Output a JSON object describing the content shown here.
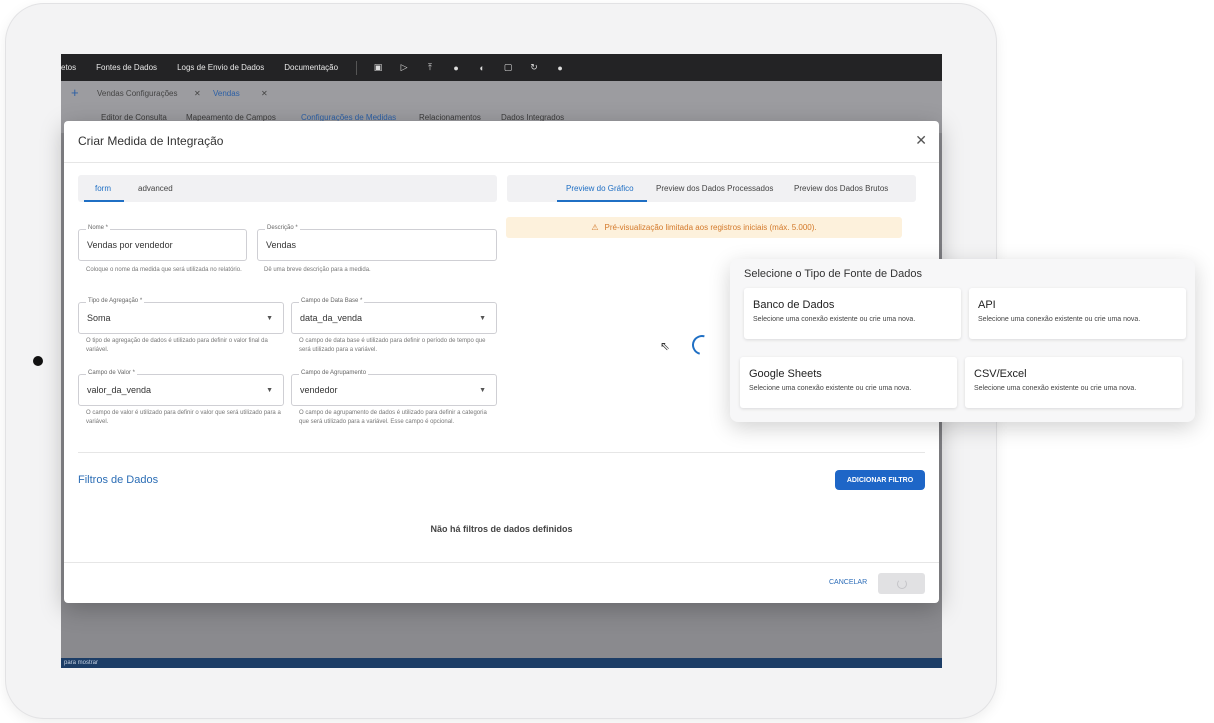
{
  "topbar": {
    "nav": [
      "etos",
      "Fontes de Dados",
      "Logs de Envio de Dados",
      "Documentação"
    ],
    "icons": [
      "save-icon",
      "play-icon",
      "upload-icon",
      "globe-icon",
      "contrast-icon",
      "chat-icon",
      "refresh-icon",
      "user-icon"
    ]
  },
  "bgtabs": {
    "plus": "+",
    "tab1": "Vendas Configurações",
    "tab2": "Vendas",
    "sub": [
      "Editor de Consulta",
      "Mapeamento de Campos",
      "Configurações de Medidas",
      "Relacionamentos",
      "Dados Integrados"
    ]
  },
  "bottom_text": "para mostrar",
  "modal": {
    "title": "Criar Medida de Integração",
    "close": "✕",
    "tabs_left": [
      "form",
      "advanced"
    ],
    "tabs_right": [
      "Preview do Gráfico",
      "Preview dos Dados Processados",
      "Preview dos Dados Brutos"
    ],
    "fields": {
      "nome": {
        "label": "Nome *",
        "value": "Vendas por vendedor",
        "help": "Coloque o nome da medida que será utilizada no relatório."
      },
      "descricao": {
        "label": "Descrição *",
        "value": "Vendas",
        "help": "Dê uma breve descrição para a medida."
      },
      "agregacao": {
        "label": "Tipo de Agregação *",
        "value": "Soma",
        "help": "O tipo de agregação de dados é utilizado para definir o valor final da variável."
      },
      "data_base": {
        "label": "Campo de Data Base *",
        "value": "data_da_venda",
        "help": "O campo de data base é utilizado para definir o período de tempo que será utilizado para a variável."
      },
      "valor": {
        "label": "Campo de Valor *",
        "value": "valor_da_venda",
        "help": "O campo de valor é utilizado para definir o valor que será utilizado para a variável."
      },
      "agrupamento": {
        "label": "Campo de Agrupamento",
        "value": "vendedor",
        "help": "O campo de agrupamento de dados é utilizado para definir a categoria que será utilizado para a variável. Esse campo é opcional."
      }
    },
    "warning": "Pré-visualização limitada aos registros iniciais (máx. 5.000).",
    "filters_title": "Filtros de Dados",
    "add_filter": "ADICIONAR FILTRO",
    "no_filters": "Não há filtros de dados definidos",
    "cancel": "CANCELAR"
  },
  "datasource": {
    "title": "Selecione o Tipo de Fonte de Dados",
    "options": [
      {
        "title": "Banco de Dados",
        "desc": "Selecione uma conexão existente ou crie uma nova."
      },
      {
        "title": "API",
        "desc": "Selecione uma conexão existente ou crie uma nova."
      },
      {
        "title": "Google Sheets",
        "desc": "Selecione uma conexão existente ou crie uma nova."
      },
      {
        "title": "CSV/Excel",
        "desc": "Selecione uma conexão existente ou crie uma nova."
      }
    ]
  },
  "colors": {
    "accent": "#1f6fc4",
    "warning_bg": "#fdf1dc",
    "warning_text": "#d3792a",
    "topbar": "#232325"
  }
}
